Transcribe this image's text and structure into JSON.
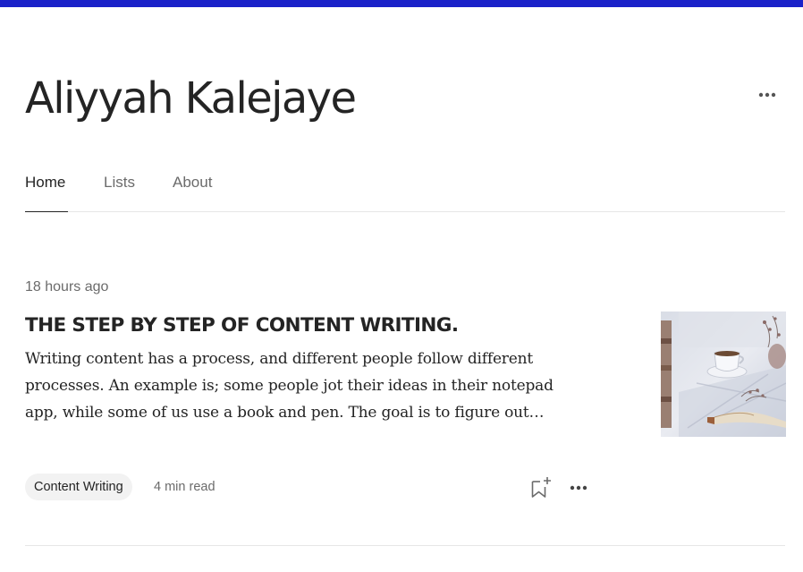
{
  "profile": {
    "name": "Aliyyah Kalejaye",
    "more_icon": "more-horizontal-icon"
  },
  "tabs": [
    {
      "label": "Home",
      "active": true
    },
    {
      "label": "Lists",
      "active": false
    },
    {
      "label": "About",
      "active": false
    }
  ],
  "post": {
    "timestamp": "18 hours ago",
    "title": "THE STEP BY STEP OF CONTENT WRITING.",
    "excerpt_lines": [
      "Writing content has a process, and different people follow different",
      "processes. An example is; some people jot their ideas in their notepad",
      "app, while some of us use a book and pen. The goal is to figure out…"
    ],
    "tag": "Content Writing",
    "read_time": "4 min read",
    "save_icon": "bookmark-plus-icon",
    "more_icon": "more-horizontal-icon"
  },
  "colors": {
    "top_bar": "#1b22c9",
    "text_primary": "#242424",
    "text_secondary": "#6b6b6b",
    "tag_bg": "#f2f2f2",
    "divider": "#e6e6e6"
  }
}
